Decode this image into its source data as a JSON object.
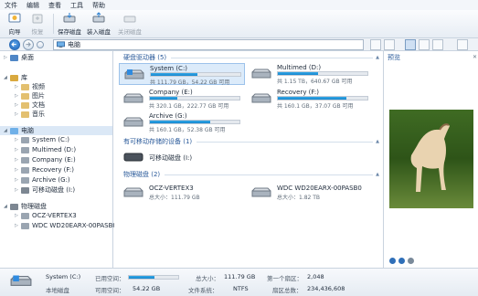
{
  "menu": [
    "文件",
    "编辑",
    "查看",
    "工具",
    "帮助"
  ],
  "toolbar": {
    "wizard": "向导",
    "restore": "恢复",
    "save_disk": "保存磁盘",
    "load_disk": "装入磁盘",
    "close_disk": "关闭磁盘"
  },
  "address": {
    "path": "电脑"
  },
  "tree": {
    "desktop": "桌面",
    "library": "库",
    "videos": "视频",
    "pictures": "图片",
    "documents": "文档",
    "music": "音乐",
    "computer": "电脑",
    "drive_c": "System (C:)",
    "drive_d": "Multimed (D:)",
    "drive_e": "Company (E:)",
    "drive_f": "Recovery (F:)",
    "drive_g": "Archive (G:)",
    "removable": "可移动磁盘 (I:)",
    "physical": "物理磁盘",
    "disk1": "OCZ-VERTEX3",
    "disk2": "WDC WD20EARX-00PASB0"
  },
  "groups": {
    "hdd": "硬盘驱动器 (5)",
    "removable": "有可移动存储的设备 (1)",
    "physical": "物理磁盘 (2)"
  },
  "drives": [
    {
      "name": "System (C:)",
      "info": "共 111.79 GB，54.22 GB 可用",
      "fill": 0.52
    },
    {
      "name": "Multimed (D:)",
      "info": "共 1.15 TB，640.67 GB 可用",
      "fill": 0.45
    },
    {
      "name": "Company (E:)",
      "info": "共 320.1 GB，222.77 GB 可用",
      "fill": 0.31
    },
    {
      "name": "Recovery (F:)",
      "info": "共 160.1 GB，37.07 GB 可用",
      "fill": 0.77
    },
    {
      "name": "Archive (G:)",
      "info": "共 160.1 GB，52.38 GB 可用",
      "fill": 0.67
    }
  ],
  "removable": {
    "name": "可移动磁盘 (I:)"
  },
  "physical": [
    {
      "name": "OCZ-VERTEX3",
      "size": "总大小：111.79 GB"
    },
    {
      "name": "WDC WD20EARX-00PASB0",
      "size": "总大小：1.82 TB"
    }
  ],
  "preview": {
    "title": "预览"
  },
  "status": {
    "name": "System (C:)",
    "type": "本地磁盘",
    "used_label": "已用空间：",
    "free_label": "可用空间：",
    "free_value": "54.22 GB",
    "used_fill": 0.52,
    "total_label": "总大小：",
    "total_value": "111.79 GB",
    "fs_label": "文件系统：",
    "fs_value": "NTFS",
    "first_sector_label": "第一个扇区：",
    "first_sector_value": "2,048",
    "sector_count_label": "扇区总数：",
    "sector_count_value": "234,436,608"
  },
  "colors": {
    "accent": "#1586cf",
    "selection": "#dcebfa"
  }
}
